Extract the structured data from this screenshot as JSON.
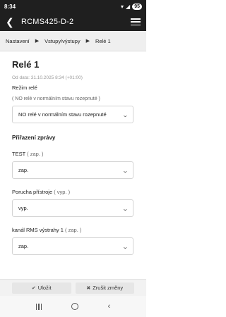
{
  "status_bar": {
    "time": "8:34",
    "battery": "95"
  },
  "header": {
    "title": "RCMS425-D-2"
  },
  "breadcrumb": [
    "Nastavení",
    "Vstupy/výstupy",
    "Relé 1"
  ],
  "page": {
    "title": "Relé 1",
    "meta": "Od data: 31.10.2025 8:34 (+01:00)",
    "relay_mode_label": "Režim relé",
    "relay_mode_hint": "( NO relé v normálním stavu rozepnuté )",
    "relay_mode_value": "NO relé v normálním stavu rozepnuté",
    "section_title": "Přiřazení zprávy"
  },
  "fields": [
    {
      "label": "TEST",
      "sub": "( zap. )",
      "value": "zap."
    },
    {
      "label": "Porucha přístroje",
      "sub": "( vyp. )",
      "value": "vyp."
    },
    {
      "label": "kanál RMS výstrahy 1",
      "sub": "( zap. )",
      "value": "zap."
    }
  ],
  "footer": {
    "save_label": "Uložit",
    "cancel_label": "Zrušit změny"
  }
}
